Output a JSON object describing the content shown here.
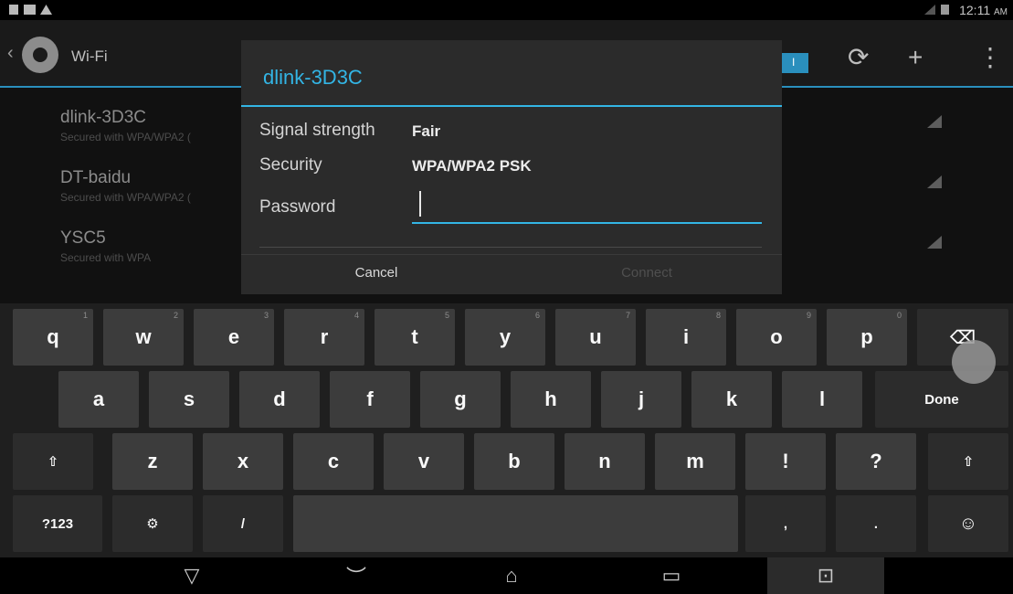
{
  "status_bar": {
    "time": "12:11",
    "ampm": "AM",
    "icons": [
      "lock-icon",
      "image-icon",
      "warning-icon",
      "signal-icon",
      "battery-icon"
    ]
  },
  "action_bar": {
    "title": "Wi-Fi",
    "back_glyph": "‹",
    "refresh_glyph": "⟳",
    "add_glyph": "+",
    "overflow_glyph": "⋮",
    "toggle_label": "I"
  },
  "wifi_list": [
    {
      "name": "dlink-3D3C",
      "subtitle": "Secured with WPA/WPA2 ("
    },
    {
      "name": "DT-baidu",
      "subtitle": "Secured with WPA/WPA2 ("
    },
    {
      "name": "YSC5",
      "subtitle": "Secured with WPA"
    }
  ],
  "dialog": {
    "title": "dlink-3D3C",
    "signal_label": "Signal strength",
    "signal_value": "Fair",
    "security_label": "Security",
    "security_value": "WPA/WPA2 PSK",
    "password_label": "Password",
    "password_value": "",
    "cancel_label": "Cancel",
    "connect_label": "Connect"
  },
  "keyboard": {
    "row1": [
      {
        "label": "q",
        "hint": "1"
      },
      {
        "label": "w",
        "hint": "2"
      },
      {
        "label": "e",
        "hint": "3"
      },
      {
        "label": "r",
        "hint": "4"
      },
      {
        "label": "t",
        "hint": "5"
      },
      {
        "label": "y",
        "hint": "6"
      },
      {
        "label": "u",
        "hint": "7"
      },
      {
        "label": "i",
        "hint": "8"
      },
      {
        "label": "o",
        "hint": "9"
      },
      {
        "label": "p",
        "hint": "0"
      }
    ],
    "row2": [
      "a",
      "s",
      "d",
      "f",
      "g",
      "h",
      "j",
      "k",
      "l"
    ],
    "row3": [
      "z",
      "x",
      "c",
      "v",
      "b",
      "n",
      "m",
      "!",
      "?"
    ],
    "backspace_glyph": "⌫",
    "done_label": "Done",
    "shift_glyph": "⇧",
    "symbols_label": "?123",
    "settings_glyph": "⚙",
    "slash_label": "/",
    "comma_label": ",",
    "period_label": ".",
    "emoji_glyph": "☺"
  },
  "nav_bar": {
    "hide_keyboard_glyph": "▽",
    "back_glyph": "︶",
    "home_glyph": "⌂",
    "recents_glyph": "▭",
    "screenshot_glyph": "⊡"
  }
}
